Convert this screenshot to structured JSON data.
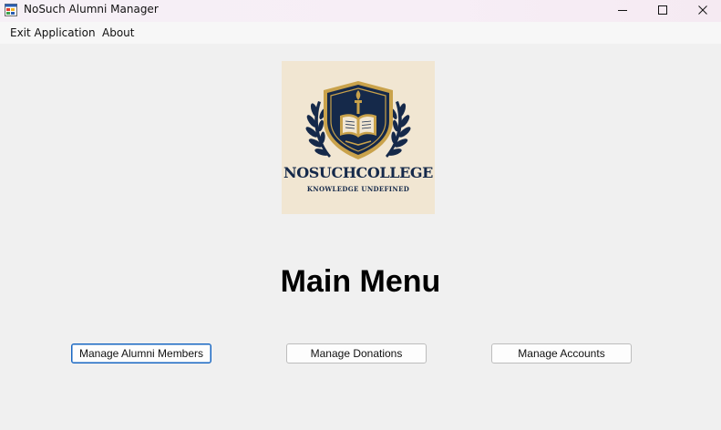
{
  "window": {
    "title": "NoSuch Alumni Manager"
  },
  "menu": {
    "exit_label": "Exit Application",
    "about_label": "About"
  },
  "logo": {
    "name": "NOSUCHCOLLEGE",
    "tagline": "KNOWLEDGE UNDEFINED",
    "colors": {
      "background": "#f1e6d2",
      "navy": "#15294a",
      "gold": "#c9a24b"
    }
  },
  "main": {
    "heading": "Main Menu",
    "buttons": {
      "alumni": "Manage Alumni Members",
      "donations": "Manage Donations",
      "accounts": "Manage Accounts"
    },
    "focused_button": "alumni"
  },
  "icons": {
    "app": "app-window-icon",
    "minimize": "minimize-icon",
    "maximize": "maximize-icon",
    "close": "close-icon"
  }
}
